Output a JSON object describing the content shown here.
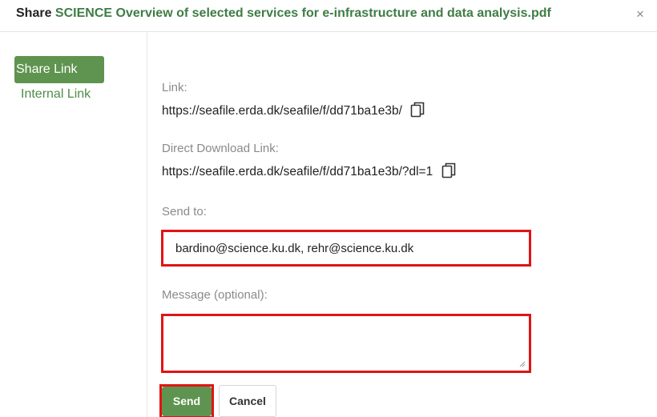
{
  "header": {
    "verb": "Share",
    "filename": "SCIENCE Overview of selected services for e-infrastructure and data analysis.pdf",
    "close_glyph": "×"
  },
  "sidebar": {
    "items": [
      {
        "label": "Share Link",
        "active": true
      },
      {
        "label": "Internal Link",
        "active": false
      }
    ]
  },
  "main": {
    "link_label": "Link:",
    "link_value": "https://seafile.erda.dk/seafile/f/dd71ba1e3b/",
    "direct_label": "Direct Download Link:",
    "direct_value": "https://seafile.erda.dk/seafile/f/dd71ba1e3b/?dl=1",
    "send_to_label": "Send to:",
    "send_to_value": "bardino@science.ku.dk, rehr@science.ku.dk",
    "message_label": "Message (optional):",
    "message_value": "",
    "send_button": "Send",
    "cancel_button": "Cancel"
  },
  "colors": {
    "accent": "#5f9450",
    "link_green": "#3e7d44",
    "highlight": "#e01414"
  },
  "icons": {
    "copy": "copy-icon",
    "close": "close-icon"
  }
}
